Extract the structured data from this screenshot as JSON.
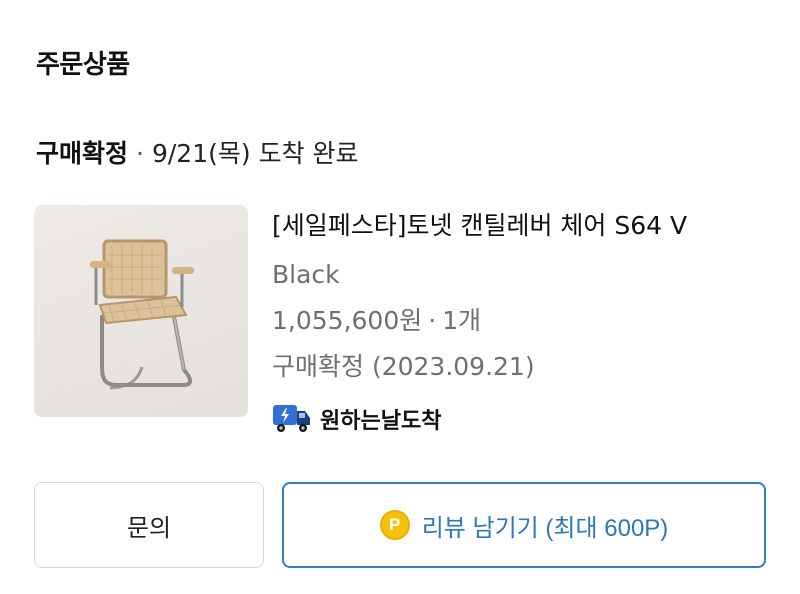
{
  "section": {
    "title": "주문상품"
  },
  "order": {
    "status": "구매확정",
    "separator": "·",
    "delivery_date": "9/21(목)",
    "delivery_status": "도착 완료"
  },
  "product": {
    "name": "[세일페스타]토넷 캔틸레버 체어 S64 V",
    "option": "Black",
    "price": "1,055,600원",
    "separator": "·",
    "quantity": "1개",
    "confirm_text": "구매확정 (2023.09.21)",
    "thumbnail_icon": "chair-image"
  },
  "delivery_badge": {
    "icon": "truck-icon",
    "label": "원하는날도착"
  },
  "buttons": {
    "inquiry_label": "문의",
    "review_label": "리뷰 남기기 (최대 600P)",
    "point_icon_text": "P"
  },
  "colors": {
    "accent_blue": "#2c78b8",
    "point_yellow": "#f6c10c",
    "truck_blue": "#2f6fd6"
  }
}
